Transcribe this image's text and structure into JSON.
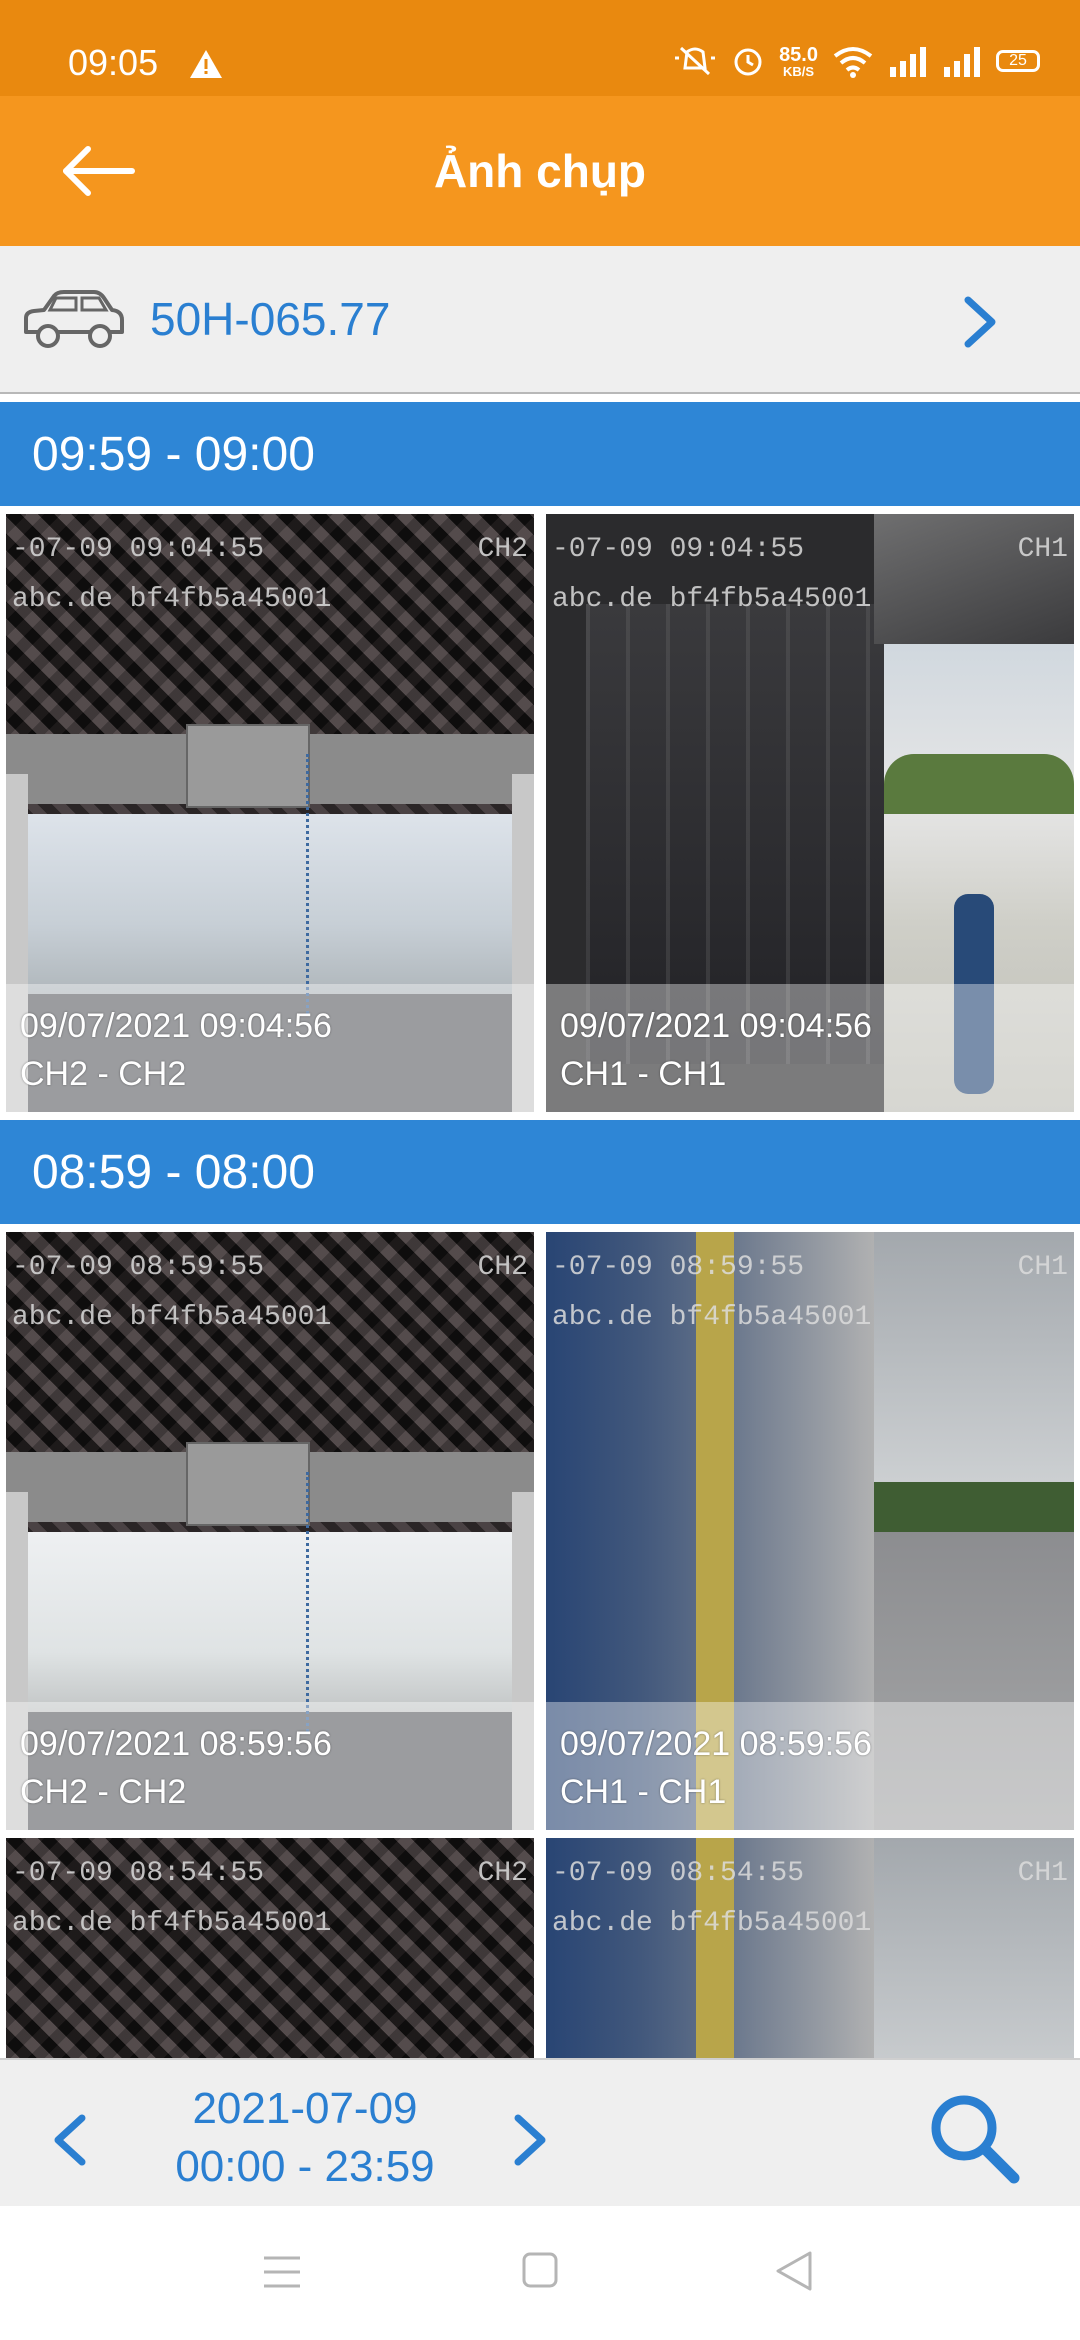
{
  "status_bar": {
    "time": "09:05",
    "speed_value": "85.0",
    "speed_unit": "KB/S",
    "battery": "25"
  },
  "app_bar": {
    "title": "Ảnh chụp"
  },
  "vehicle": {
    "plate": "50H-065.77"
  },
  "sections": [
    {
      "range": "09:59 - 09:00",
      "photos": [
        {
          "overlay_date": "-07-09 09:04:55",
          "overlay_id": "abc.de bf4fb5a45001",
          "overlay_channel": "CH2",
          "timestamp": "09/07/2021 09:04:56",
          "channel": "CH2 - CH2"
        },
        {
          "overlay_date": "-07-09 09:04:55",
          "overlay_id": "abc.de bf4fb5a45001",
          "overlay_channel": "CH1",
          "timestamp": "09/07/2021 09:04:56",
          "channel": "CH1 - CH1"
        }
      ]
    },
    {
      "range": "08:59 - 08:00",
      "photos": [
        {
          "overlay_date": "-07-09 08:59:55",
          "overlay_id": "abc.de bf4fb5a45001",
          "overlay_channel": "CH2",
          "timestamp": "09/07/2021 08:59:56",
          "channel": "CH2 - CH2"
        },
        {
          "overlay_date": "-07-09 08:59:55",
          "overlay_id": "abc.de bf4fb5a45001",
          "overlay_channel": "CH1",
          "timestamp": "09/07/2021 08:59:56",
          "channel": "CH1 - CH1"
        },
        {
          "overlay_date": "-07-09 08:54:55",
          "overlay_id": "abc.de bf4fb5a45001",
          "overlay_channel": "CH2"
        },
        {
          "overlay_date": "-07-09 08:54:55",
          "overlay_id": "abc.de bf4fb5a45001",
          "overlay_channel": "CH1"
        }
      ]
    }
  ],
  "bottom_bar": {
    "date": "2021-07-09",
    "time_range": "00:00 - 23:59"
  },
  "colors": {
    "status_bar": "#e9890f",
    "app_bar": "#f5961e",
    "section_header": "#2e86d6",
    "accent_text": "#2a7fd1"
  },
  "icons": [
    "warning-icon",
    "mute-icon",
    "alarm-icon",
    "wifi-icon",
    "signal-icon",
    "battery-icon",
    "back-arrow-icon",
    "car-icon",
    "chevron-right-icon",
    "chevron-left-icon",
    "search-icon",
    "nav-menu-icon",
    "nav-home-icon",
    "nav-back-icon"
  ]
}
